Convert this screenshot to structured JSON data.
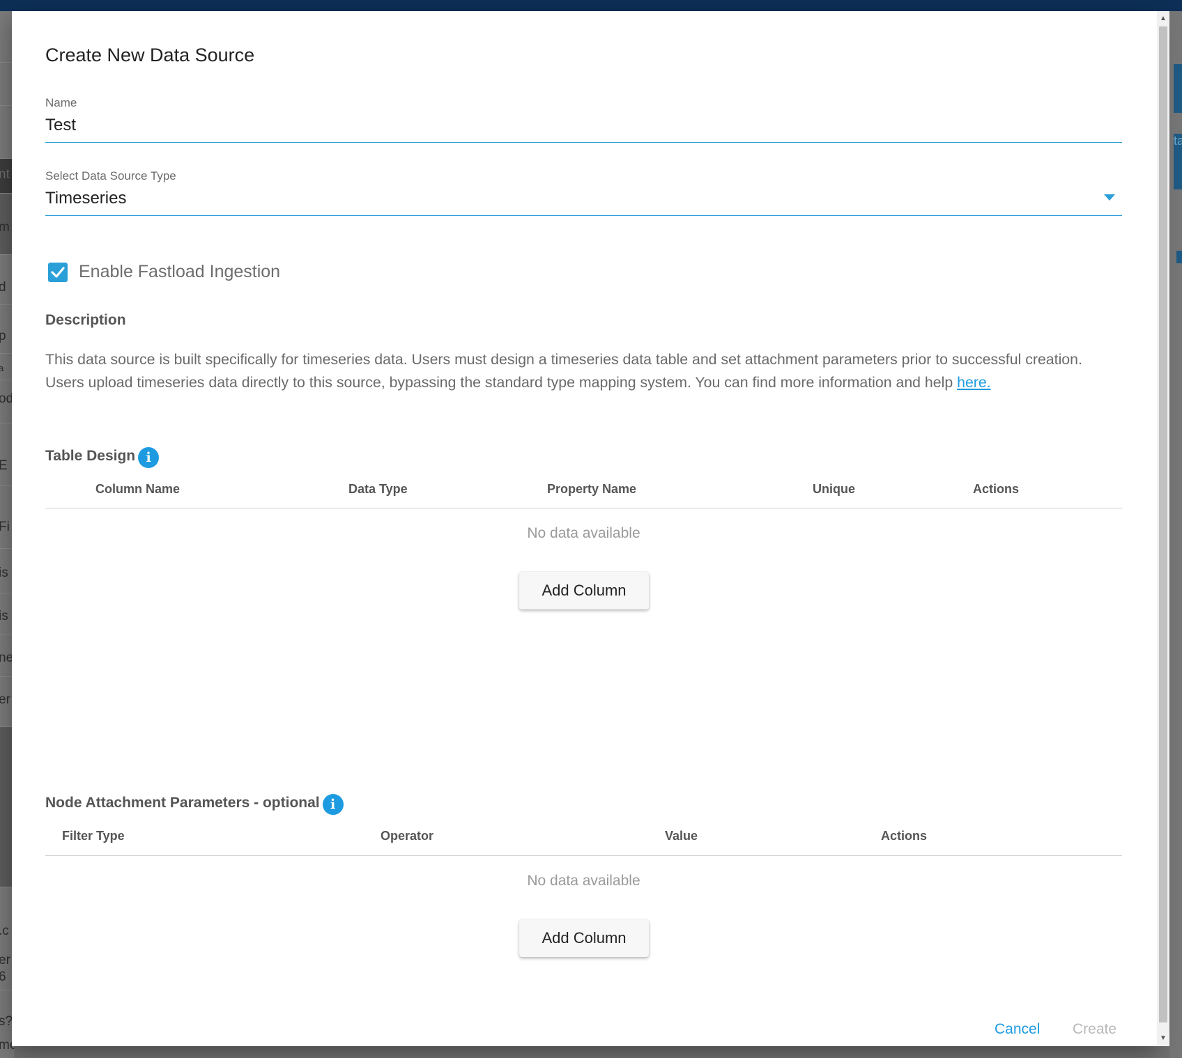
{
  "background": {
    "left_fragments": [
      "nt",
      "m",
      "d",
      "p",
      "a",
      "od",
      "E",
      "Fi",
      "is",
      "is",
      "ne",
      "er",
      ".c",
      "er",
      "6",
      "s?",
      "me"
    ],
    "right_fragments": [
      "ta"
    ]
  },
  "dialog": {
    "title": "Create New Data Source",
    "name_field": {
      "label": "Name",
      "value": "Test"
    },
    "type_field": {
      "label": "Select Data Source Type",
      "value": "Timeseries"
    },
    "fastload": {
      "label": "Enable Fastload Ingestion",
      "checked": true
    },
    "description": {
      "heading": "Description",
      "text": "This data source is built specifically for timeseries data. Users must design a timeseries data table and set attachment parameters prior to successful creation. Users upload timeseries data directly to this source, bypassing the standard type mapping system. You can find more information and help ",
      "link": "here."
    },
    "table_design": {
      "heading": "Table Design",
      "columns": [
        "Column Name",
        "Data Type",
        "Property Name",
        "Unique",
        "Actions"
      ],
      "empty_text": "No data available",
      "button": "Add Column"
    },
    "node_attachment": {
      "heading": "Node Attachment Parameters - optional",
      "columns": [
        "Filter Type",
        "Operator",
        "Value",
        "Actions"
      ],
      "empty_text": "No data available",
      "button": "Add Column"
    },
    "footer": {
      "cancel": "Cancel",
      "create": "Create"
    }
  },
  "colors": {
    "accent": "#2a9fd8",
    "info": "#1e9be0",
    "disabled": "#b9b9b9"
  },
  "icons": {
    "info": "info-icon",
    "checkbox": "check-icon",
    "dropdown": "dropdown-caret-icon"
  }
}
